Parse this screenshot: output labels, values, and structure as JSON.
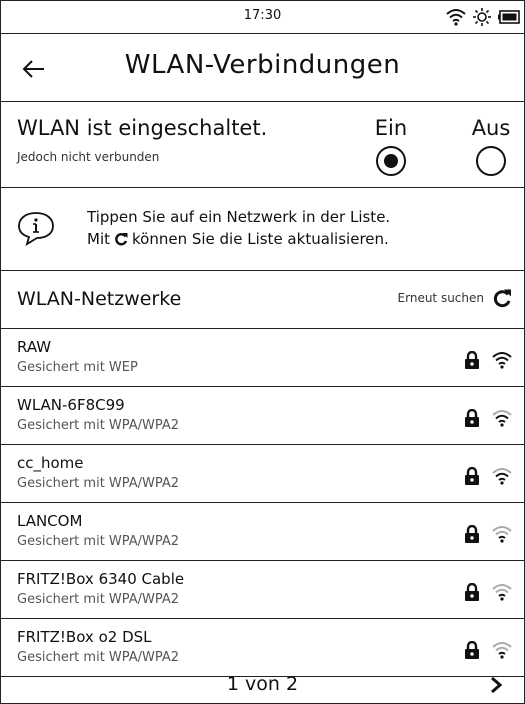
{
  "status_bar": {
    "time": "17:30",
    "icons": [
      "wifi-icon",
      "frontlight-icon",
      "battery-icon"
    ]
  },
  "header": {
    "title": "WLAN-Verbindungen",
    "back_icon": "arrow-left-icon"
  },
  "wlan_state": {
    "label": "WLAN ist eingeschaltet.",
    "sublabel": "Jedoch nicht verbunden",
    "on_label": "Ein",
    "off_label": "Aus",
    "selected": "Ein"
  },
  "info": {
    "line1": "Tippen Sie auf ein Netzwerk in der Liste.",
    "line2_prefix": "Mit",
    "line2_suffix": "können Sie die Liste aktualisieren.",
    "icon": "info-bubble-icon"
  },
  "networks_header": {
    "title": "WLAN-Netzwerke",
    "rescan_label": "Erneut suchen",
    "rescan_icon": "refresh-icon"
  },
  "networks": [
    {
      "name": "RAW",
      "security": "Gesichert mit WEP",
      "signal": "strong"
    },
    {
      "name": "WLAN-6F8C99",
      "security": "Gesichert mit WPA/WPA2",
      "signal": "medium"
    },
    {
      "name": "cc_home",
      "security": "Gesichert mit WPA/WPA2",
      "signal": "medium"
    },
    {
      "name": "LANCOM",
      "security": "Gesichert mit WPA/WPA2",
      "signal": "weak"
    },
    {
      "name": "FRITZ!Box 6340 Cable",
      "security": "Gesichert mit WPA/WPA2",
      "signal": "weak"
    },
    {
      "name": "FRITZ!Box o2 DSL",
      "security": "Gesichert mit WPA/WPA2",
      "signal": "weak"
    }
  ],
  "pagination": {
    "label": "1 von 2",
    "next_icon": "chevron-right-icon"
  },
  "colors": {
    "text": "#111111",
    "secondary": "#555555",
    "border": "#222222",
    "signal_faded": "#aaaaaa"
  }
}
